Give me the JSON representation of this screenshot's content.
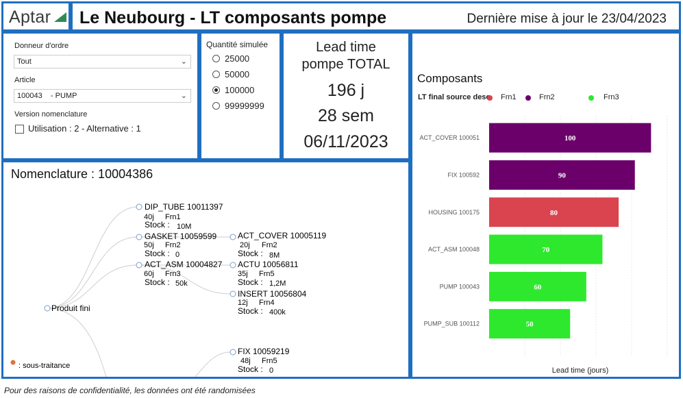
{
  "header": {
    "logo": "Aptar",
    "title": "Le Neubourg - LT composants pompe",
    "updated_label": "Dernière mise à jour le",
    "updated_date": "23/04/2023"
  },
  "filters": {
    "donneur_label": "Donneur d'ordre",
    "donneur_value": "Tout",
    "article_label": "Article",
    "article_value": "100043    - PUMP",
    "version_label": "Version nomenclature",
    "version_option": "Utilisation : 2 - Alternative : 1"
  },
  "quantity": {
    "label": "Quantité simulée",
    "options": [
      "25000",
      "50000",
      "100000",
      "99999999"
    ],
    "selected": "100000"
  },
  "lead": {
    "line1": "Lead time",
    "line2": "pompe TOTAL",
    "days": "196 j",
    "weeks": "28 sem",
    "date": "06/11/2023"
  },
  "nomenclature": {
    "title": "Nomenclature : 10004386",
    "root": "Produit fini",
    "stock_label": "Stock :",
    "nodes": [
      {
        "name": "DIP_TUBE 10011397",
        "lt": "40j",
        "frn": "Frn1",
        "stock": "10M"
      },
      {
        "name": "GASKET 10059599",
        "lt": "50j",
        "frn": "Frn2",
        "stock": "0"
      },
      {
        "name": "ACT_ASM 10004827",
        "lt": "60j",
        "frn": "Frn3",
        "stock": "50k"
      },
      {
        "name": "ACT_COVER 10005119",
        "lt": "20j",
        "frn": "Frn2",
        "stock": "8M"
      },
      {
        "name": "ACTU 10056811",
        "lt": "35j",
        "frn": "Frn5",
        "stock": "1,2M"
      },
      {
        "name": "INSERT 10056804",
        "lt": "12j",
        "frn": "Frn4",
        "stock": "400k"
      },
      {
        "name": "FIX 10059219",
        "lt": "48j",
        "frn": "Frn5",
        "stock": "0"
      }
    ],
    "legend_text": ": sous-traitance",
    "legend_color": "#e0733a"
  },
  "components": {
    "title": "Composants",
    "legend_title": "LT final source desc",
    "legend": [
      {
        "name": "Frn1",
        "color": "#d9444f"
      },
      {
        "name": "Frn2",
        "color": "#6b006b"
      },
      {
        "name": "Frn3",
        "color": "#2ee82e"
      }
    ],
    "xlabel": "Lead time (jours)"
  },
  "chart_data": {
    "type": "bar",
    "orientation": "horizontal",
    "categories": [
      "ACT_COVER 100051",
      "FIX 100592",
      "HOUSING 100175",
      "ACT_ASM 100048",
      "PUMP 100043",
      "PUMP_SUB 100112"
    ],
    "values": [
      100,
      90,
      80,
      70,
      60,
      50
    ],
    "colors": [
      "#6b006b",
      "#6b006b",
      "#d9444f",
      "#2ee82e",
      "#2ee82e",
      "#2ee82e"
    ],
    "xlabel": "Lead time (jours)",
    "xlim": [
      0,
      110
    ],
    "grid": true
  },
  "footer": "Pour des raisons de confidentialité, les données ont été randomisées"
}
